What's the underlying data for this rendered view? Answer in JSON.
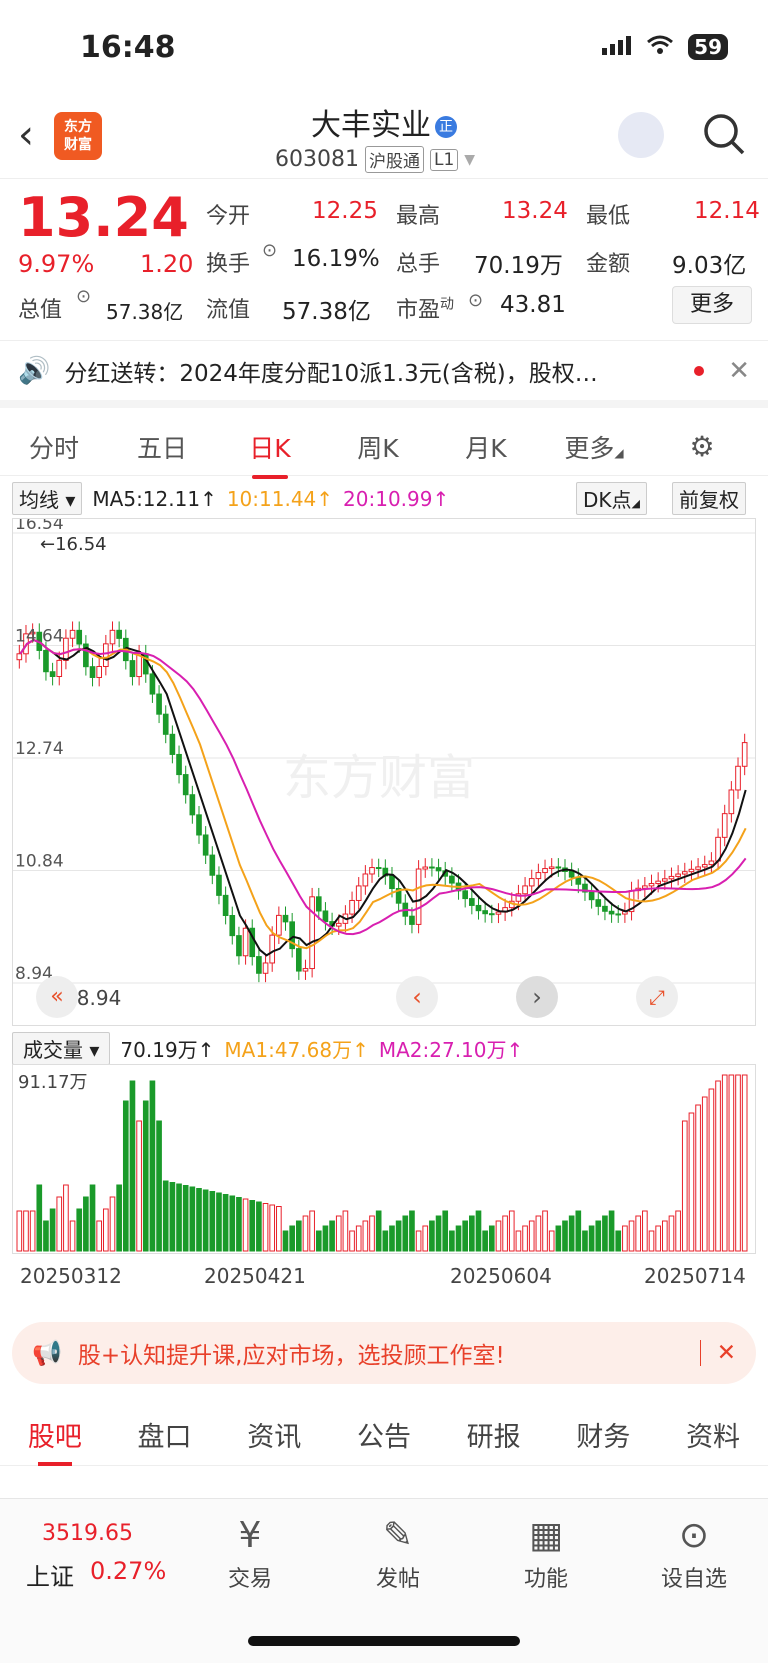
{
  "status": {
    "time": "16:48",
    "battery": "59"
  },
  "header": {
    "logo": "东方财富",
    "name": "大丰实业",
    "name_badge": "正",
    "code": "603081",
    "tag1": "沪股通",
    "tag2": "L1"
  },
  "quote": {
    "price": "13.24",
    "pct": "9.97%",
    "chg": "1.20",
    "items": [
      {
        "label": "今开",
        "value": "12.25"
      },
      {
        "label": "最高",
        "value": "13.24"
      },
      {
        "label": "最低",
        "value": "12.14"
      },
      {
        "label": "换手",
        "value": "16.19%"
      },
      {
        "label": "总手",
        "value": "70.19万"
      },
      {
        "label": "金额",
        "value": "9.03亿"
      },
      {
        "label": "总值",
        "value": "57.38亿"
      },
      {
        "label": "流值",
        "value": "57.38亿"
      },
      {
        "label": "市盈",
        "sup": "动",
        "value": "43.81"
      }
    ],
    "more": "更多"
  },
  "notice": {
    "text": "分红送转：2024年度分配10派1.3元(含税)，股权…"
  },
  "tabs": [
    "分时",
    "五日",
    "日K",
    "周K",
    "月K",
    "更多"
  ],
  "ma": {
    "select": "均线",
    "ma5": "MA5:12.11↑",
    "ma10": "10:11.44↑",
    "ma20": "20:10.99↑",
    "dk": "DK点",
    "fq": "前复权",
    "color_ma10": "#f4a21a",
    "color_ma20": "#d81fb0"
  },
  "chart": {
    "yticks": [
      "16.54",
      "14.64",
      "12.74",
      "10.84",
      "8.94"
    ],
    "high_marker": "←16.54",
    "low_marker": "←8.94",
    "watermark": "东方财富"
  },
  "volume": {
    "select": "成交量",
    "vol": "70.19万↑",
    "ma1": "MA1:47.68万↑",
    "ma2": "MA2:27.10万↑",
    "max": "91.17万"
  },
  "dates": [
    "20250312",
    "20250421",
    "20250604",
    "20250714"
  ],
  "promo": {
    "text": "股+认知提升课,应对市场，选投顾工作室!"
  },
  "bottom_tabs": [
    "股吧",
    "盘口",
    "资讯",
    "公告",
    "研报",
    "财务",
    "资料"
  ],
  "bottom_bar": {
    "index_value": "3519.65",
    "index_name": "上证",
    "index_pct": "0.27%",
    "items": [
      "交易",
      "发帖",
      "功能",
      "设自选"
    ]
  },
  "chart_data": {
    "type": "candlestick",
    "ylim": [
      8.94,
      16.54
    ],
    "ma": {
      "MA5": 12.11,
      "MA10": 11.44,
      "MA20": 10.99
    },
    "last_close": 13.24
  }
}
